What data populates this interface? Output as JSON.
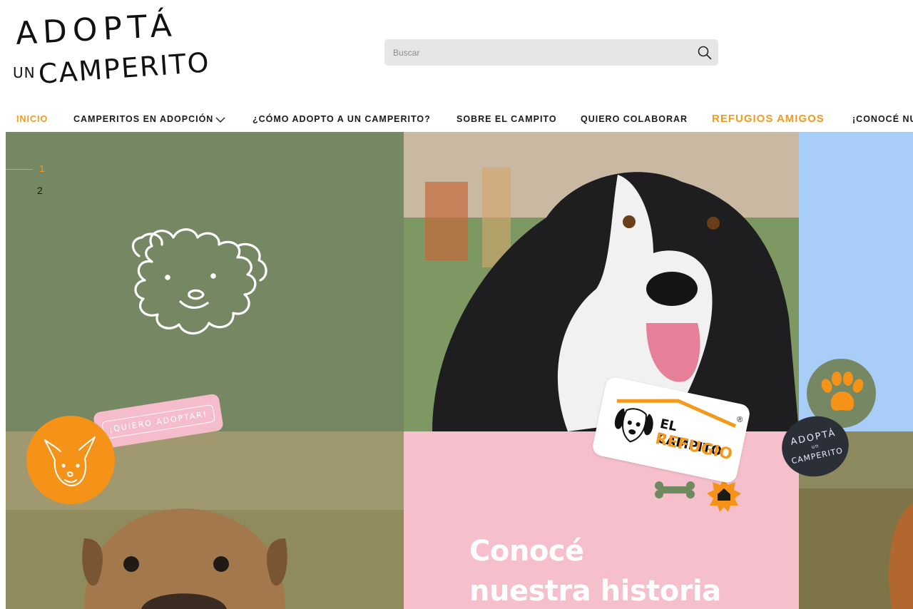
{
  "brand": {
    "logo_line1": "ADOPTÁ",
    "logo_line2_small": "UN",
    "logo_line2_big": "CAMPERITO"
  },
  "search": {
    "placeholder": "Buscar"
  },
  "nav": {
    "items": [
      {
        "label": "INICIO",
        "active": true
      },
      {
        "label": "CAMPERITOS EN ADOPCIÓN",
        "has_dropdown": true
      },
      {
        "label": "¿CÓMO ADOPTO A UN CAMPERITO?"
      },
      {
        "label": "SOBRE EL CAMPITO"
      },
      {
        "label": "QUIERO COLABORAR"
      },
      {
        "label": "REFUGIOS AMIGOS",
        "highlight": true
      },
      {
        "label": "¡CONOCÉ NU"
      }
    ]
  },
  "slider": {
    "pages": [
      "1",
      "2"
    ],
    "current": "1"
  },
  "hero": {
    "heading_line1": "Conocé",
    "heading_line2": "nuestra historia",
    "sticker_adopt": "¡QUIERO ADOPTAR!",
    "badge_campito_line1": "EL CAMPITO",
    "badge_campito_line2": "REFUGIO",
    "badge_registered": "®",
    "circle_logo_line1": "ADOPTÁ",
    "circle_logo_line2": "un",
    "circle_logo_line3": "CAMPERITO"
  },
  "colors": {
    "accent": "#f39a1d",
    "green_panel": "#768763",
    "blue_panel": "#a8cdf7",
    "pink_panel": "#f6bfcc",
    "search_bg": "#e6e6e6"
  },
  "icons": [
    "search-icon",
    "chevron-down-icon",
    "curly-dog-drawing-icon",
    "chihuahua-drawing-icon",
    "paw-icon",
    "bone-icon",
    "house-star-icon",
    "dog-face-logo-icon"
  ]
}
